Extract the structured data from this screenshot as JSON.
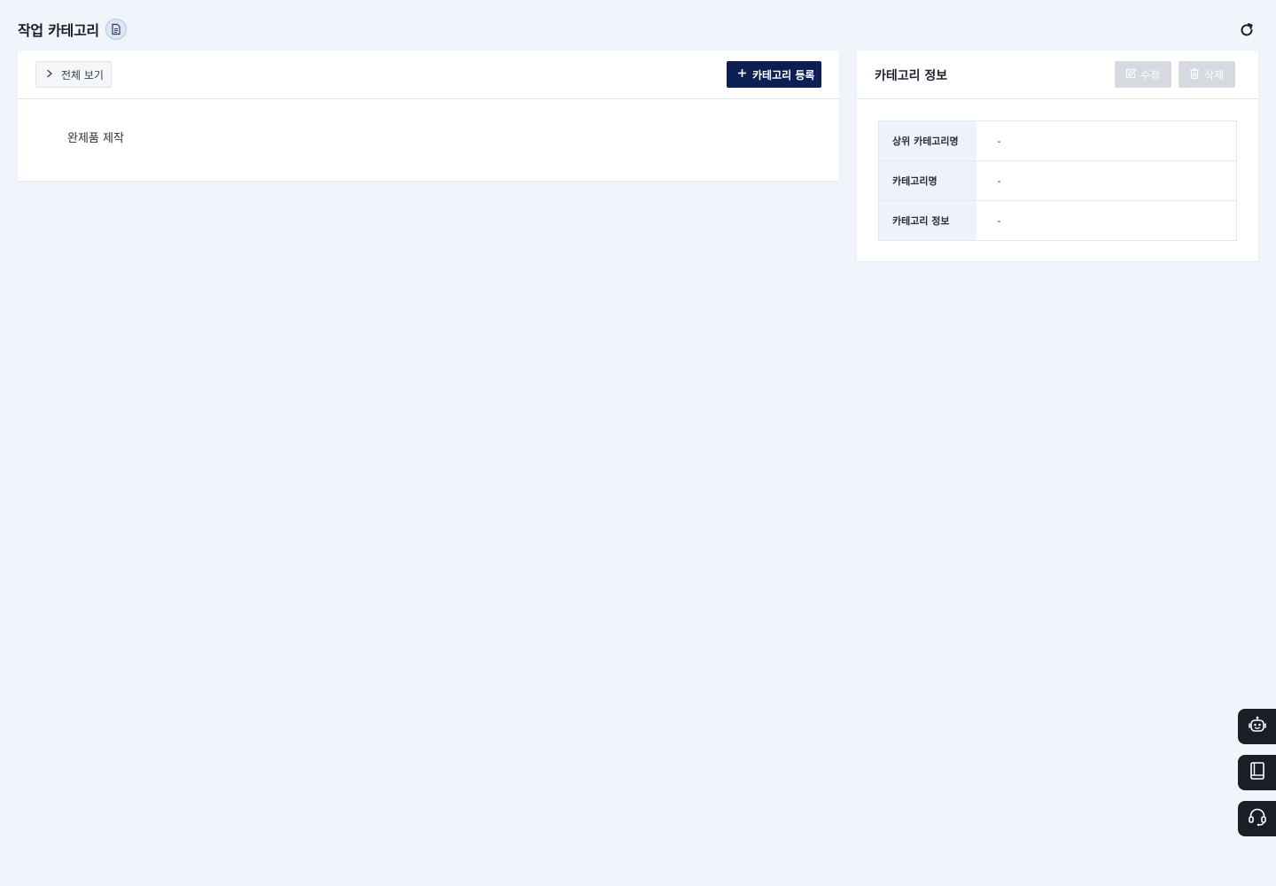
{
  "page": {
    "title": "작업 카테고리",
    "doc_icon": "document-icon",
    "refresh_icon": "refresh-icon"
  },
  "tree_panel": {
    "view_all_label": "전체 보기",
    "view_all_icon": "chevron-right-icon",
    "register_label": "카테고리 등록",
    "register_icon": "plus-icon",
    "items": [
      {
        "label": "완제품 제작"
      }
    ]
  },
  "info_panel": {
    "title": "카테고리 정보",
    "edit_label": "수정",
    "edit_icon": "edit-icon",
    "delete_label": "삭제",
    "delete_icon": "trash-icon",
    "rows": [
      {
        "label": "상위 카테고리명",
        "value": "-"
      },
      {
        "label": "카테고리명",
        "value": "-"
      },
      {
        "label": "카테고리 정보",
        "value": "-"
      }
    ]
  },
  "floating_buttons": [
    {
      "icon": "chatbot-icon"
    },
    {
      "icon": "manual-book-icon"
    },
    {
      "icon": "headset-icon"
    }
  ],
  "colors": {
    "background": "#f0f4fb",
    "primary_button": "#0c1f52",
    "disabled_button": "#d6d9df",
    "table_header_bg": "#eef3fb",
    "floating_button": "#1b1e27"
  }
}
